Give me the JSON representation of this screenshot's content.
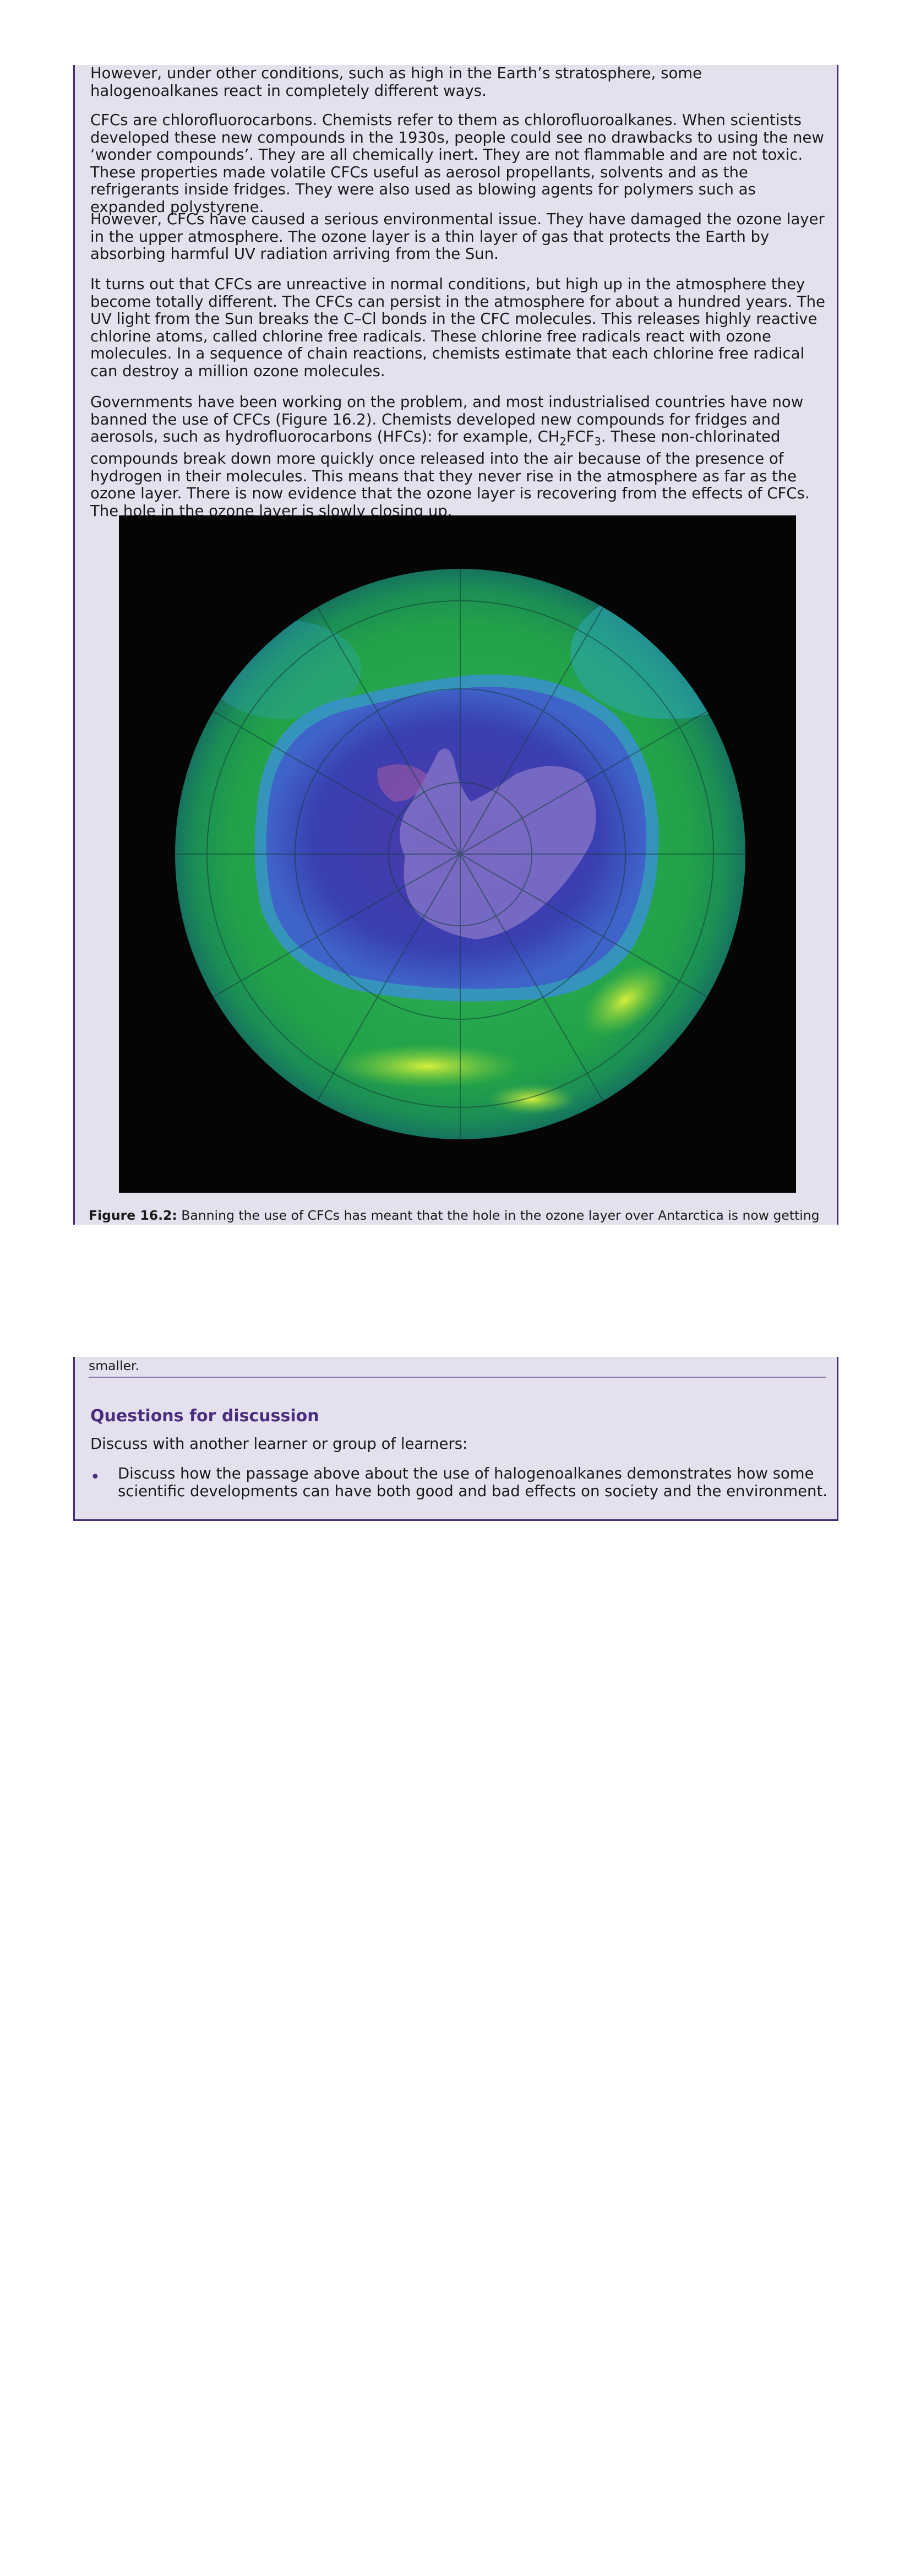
{
  "paragraphs": {
    "p1": "However, under other conditions, such as high in the Earth’s stratosphere, some halogenoalkanes react in completely different ways.",
    "p2": "CFCs are chlorofluorocarbons. Chemists refer to them as chlorofluoroalkanes. When scientists developed these new compounds in the 1930s, people could see no drawbacks to using the new ‘wonder compounds’. They are all chemically inert. They are not flammable and are not toxic. These properties made volatile CFCs useful as aerosol propellants, solvents and as the refrigerants inside fridges. They were also used as blowing agents for polymers such as expanded polystyrene.",
    "p3": "However, CFCs have caused a serious environmental issue. They have damaged the ozone layer in the upper atmosphere. The ozone layer is a thin layer of gas that protects the Earth by absorbing harmful UV radiation arriving from the Sun.",
    "p4": "It turns out that CFCs are unreactive in normal conditions, but high up in the atmosphere they become totally different. The CFCs can persist in the atmosphere for about a hundred years. The UV light from the Sun breaks the C–Cl bonds in the CFC molecules. This releases highly reactive chlorine atoms, called chlorine free radicals. These chlorine free radicals react with ozone molecules. In a sequence of chain reactions, chemists estimate that each chlorine free radical can destroy a million ozone molecules.",
    "p5_before": "Governments have been working on the problem, and most industrialised countries have now banned the use of CFCs (Figure 16.2). Chemists developed new compounds for fridges and aerosols, such as hydrofluorocarbons (HFCs): for example, CH",
    "p5_sub1": "2",
    "p5_mid": "FCF",
    "p5_sub2": "3",
    "p5_after": ". These non-chlorinated compounds break down more quickly once released into the air because of the presence of hydrogen in their molecules. This means that they never rise in the atmosphere as far as the ozone layer. There is now evidence that the ozone layer is recovering from the effects of CFCs. The hole in the ozone layer is slowly closing up."
  },
  "figure": {
    "caption_label": "Figure 16.2:",
    "caption_text_part1": "Banning the use of CFCs has meant that the hole in the ozone layer over Antarctica is now getting",
    "caption_text_part2": "smaller."
  },
  "discussion": {
    "heading": "Questions for discussion",
    "intro": "Discuss with another learner or group of learners:",
    "bullet_symbol": "•",
    "bullet": "Discuss how the passage above about the use of halogenoalkanes demonstrates how some scientific developments can have both good and bad effects on society and the environment."
  },
  "colors": {
    "box_background": "#e5e0ee",
    "accent_purple": "#4a2d7f"
  }
}
